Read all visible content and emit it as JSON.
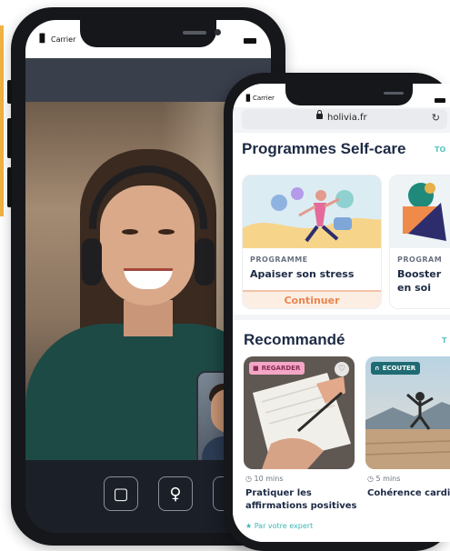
{
  "video_call": {
    "status_bar": {
      "carrier": "Carrier",
      "signal_glyph": "▐▌"
    },
    "controls": [
      {
        "name": "camera-button",
        "icon": "video-camera-icon",
        "glyph": "▢"
      },
      {
        "name": "microphone-button",
        "icon": "microphone-icon",
        "glyph": "♀"
      }
    ]
  },
  "holivia_app": {
    "status_bar": {
      "carrier": "Carrier",
      "signal_glyph": "▐▌"
    },
    "browser": {
      "url": "holivia.fr",
      "reload_glyph": "↻"
    },
    "programmes": {
      "title": "Programmes Self-care",
      "see_all": "TO",
      "cards": [
        {
          "kicker": "PROGRAMME",
          "title": "Apaiser son stress",
          "cta": "Continuer"
        },
        {
          "kicker": "PROGRAM",
          "title": "Booster en soi",
          "cta": ""
        }
      ]
    },
    "recommended": {
      "title": "Recommandé",
      "see_all": "T",
      "items": [
        {
          "badge": "REGARDER",
          "badge_icon": "video-icon",
          "badge_glyph": "■",
          "duration": "10 mins",
          "title": "Pratiquer les affirmations positives",
          "expert": "Par votre expert",
          "favorite_glyph": "♡"
        },
        {
          "badge": "ECOUTER",
          "badge_icon": "headphones-icon",
          "badge_glyph": "∩",
          "duration": "5 mins",
          "title": "Cohérence cardi"
        }
      ]
    },
    "icons": {
      "clock_glyph": "◷",
      "star_glyph": "★",
      "lock": "lock-icon"
    },
    "colors": {
      "accent_orange": "#e9854d",
      "accent_teal": "#3fb6b3",
      "navy": "#1d2a44",
      "watch_badge": "#f4a6c8",
      "listen_badge": "#1f6b73"
    }
  }
}
